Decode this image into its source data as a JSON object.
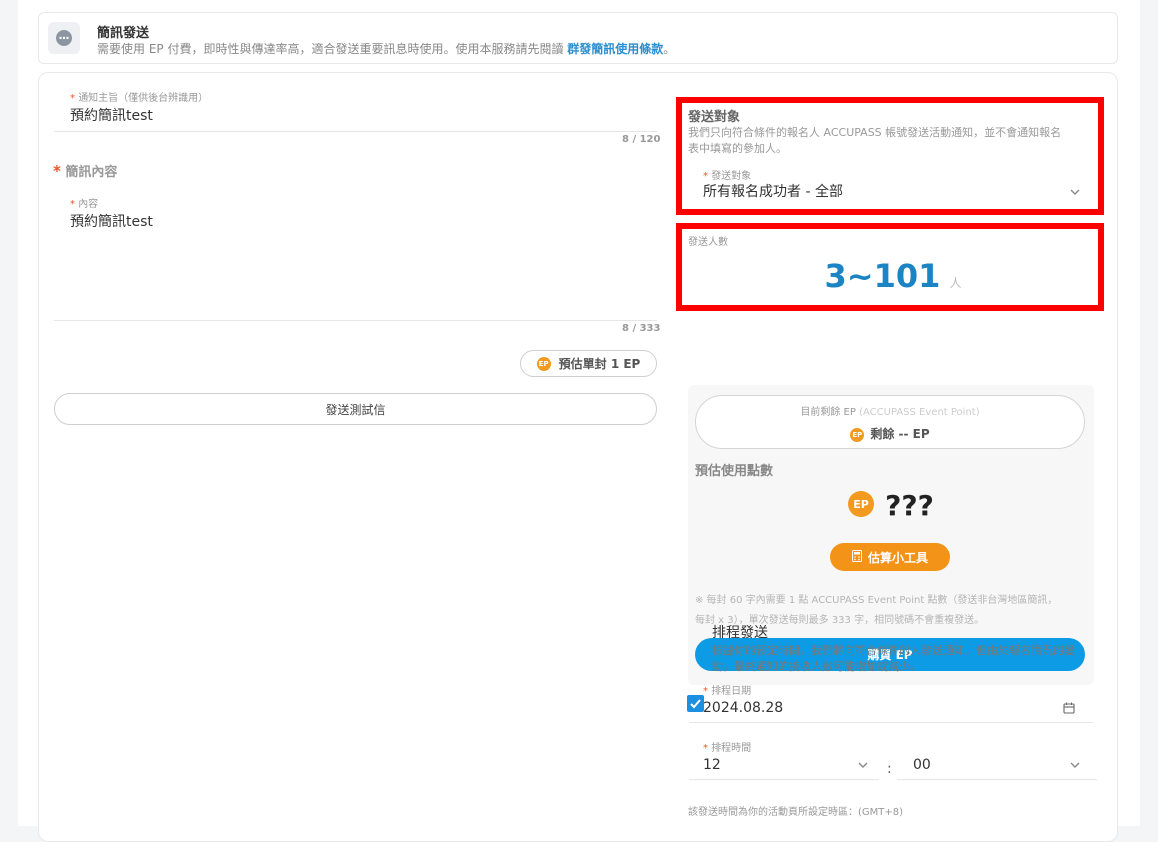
{
  "banner": {
    "title": "簡訊發送",
    "description": "需要使用 EP 付費，即時性與傳達率高，適合發送重要訊息時使用。使用本服務請先閱讀",
    "terms_link": "群發簡訊使用條款",
    "suffix": "。"
  },
  "left": {
    "subject": {
      "required_mark": "*",
      "label": "通知主旨（僅供後台辨識用）",
      "value": "預約簡訊test",
      "counter": "8 / 120"
    },
    "content_section": {
      "required_mark": "*",
      "title": "簡訊內容"
    },
    "content": {
      "required_mark": "*",
      "label": "內容",
      "value": "預約簡訊test",
      "counter": "8 / 333"
    },
    "estimate_button": "預估單封 1 EP",
    "test_button": "發送測試信"
  },
  "right": {
    "target": {
      "title": "發送對象",
      "description_line1": "我們只向符合條件的報名人 ACCUPASS 帳號發送活動通知，並不會通知報名",
      "description_line2": "表中填寫的參加人。",
      "required_mark": "*",
      "select_label": "發送對象",
      "select_value": "所有報名成功者 - 全部"
    },
    "count": {
      "label": "發送人數",
      "value": "3~101",
      "unit": "人"
    },
    "ep": {
      "remain_label": "目前剩餘 EP",
      "remain_label_sub": "(ACCUPASS Event Point)",
      "remain_value": "剩餘 -- EP",
      "estimate_title": "預估使用點數",
      "estimate_value": "???",
      "calc_button": "估算小工具",
      "note_line1": "※ 每封 60 字內需要 1 點 ACCUPASS Event Point 點數（發送非台灣地區簡訊，",
      "note_line2": "每封 x 3），單次發送每則最多 333 字，相同號碼不會重複發送。",
      "buy_button": "購買 EP",
      "badge_text": "EP"
    },
    "schedule": {
      "checked": true,
      "title": "排程發送",
      "description_line1": "根據你的預定時間，我們將向符合條件的人發送通知，但由於報名情況的變",
      "description_line2": "動，最終通知的接收人數可能增加或減少。",
      "date_required": "*",
      "date_label": "排程日期",
      "date_value": "2024.08.28",
      "time_required": "*",
      "time_label": "排程時間",
      "hour_value": "12",
      "minute_value": "00",
      "separator": ":",
      "timezone_note": "該發送時間為你的活動頁所設定時區：(GMT+8)"
    }
  },
  "colors": {
    "accent_blue": "#0e9be5",
    "ep_orange": "#f39318",
    "required_red": "#e8562a",
    "highlight_red": "#ff0000",
    "count_blue": "#1b84c4"
  }
}
